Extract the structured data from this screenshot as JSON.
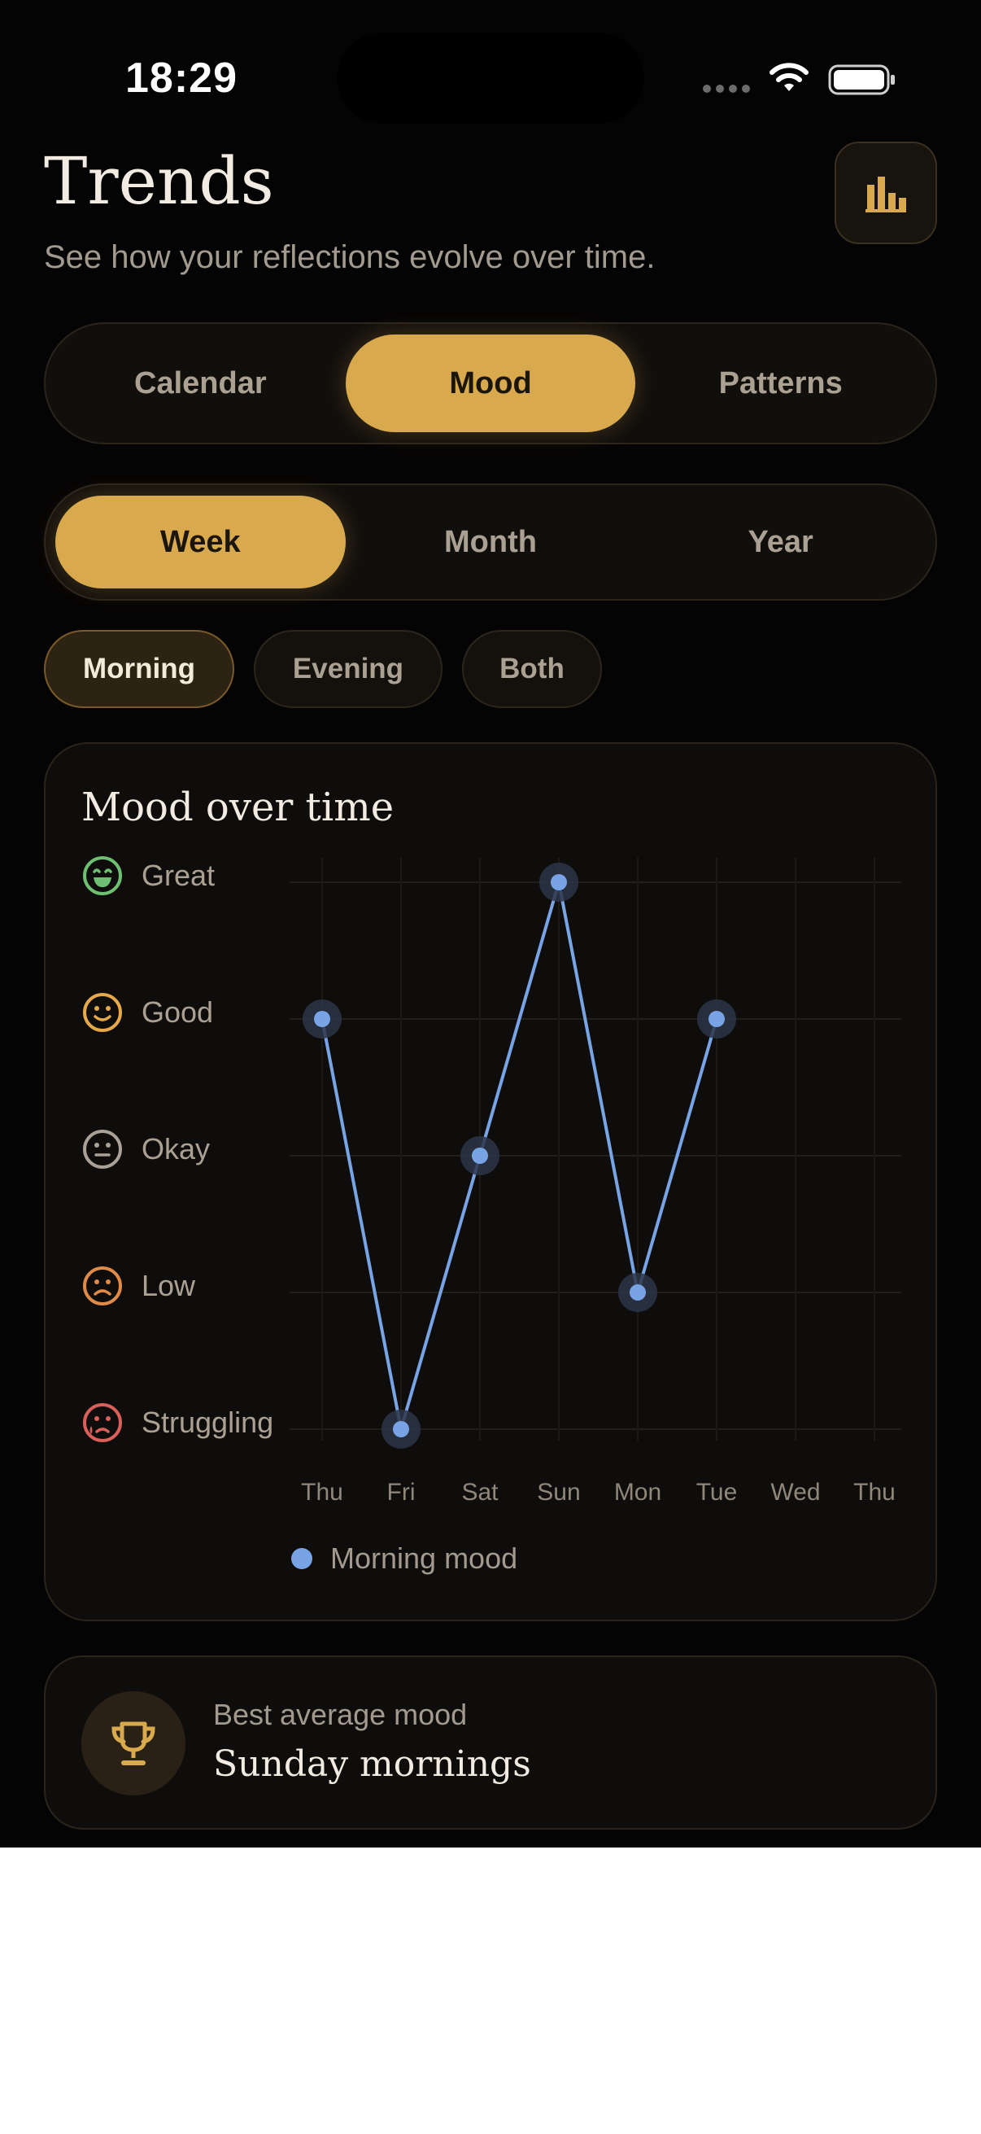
{
  "status_bar": {
    "time": "18:29"
  },
  "header": {
    "title": "Trends",
    "subtitle": "See how your reflections evolve over time.",
    "chart_button_icon": "bar-chart-icon"
  },
  "view_tabs": [
    {
      "label": "Calendar",
      "active": false
    },
    {
      "label": "Mood",
      "active": true
    },
    {
      "label": "Patterns",
      "active": false
    }
  ],
  "range_tabs": [
    {
      "label": "Week",
      "active": true
    },
    {
      "label": "Month",
      "active": false
    },
    {
      "label": "Year",
      "active": false
    }
  ],
  "time_chips": [
    {
      "label": "Morning",
      "active": true
    },
    {
      "label": "Evening",
      "active": false
    },
    {
      "label": "Both",
      "active": false
    }
  ],
  "chart_card": {
    "title": "Mood over time",
    "mood_levels": [
      {
        "label": "Great",
        "icon": "grin-face-icon",
        "color": "#6fbf73"
      },
      {
        "label": "Good",
        "icon": "smile-face-icon",
        "color": "#e6a94a"
      },
      {
        "label": "Okay",
        "icon": "neutral-face-icon",
        "color": "#a9a195"
      },
      {
        "label": "Low",
        "icon": "frown-face-icon",
        "color": "#e08a48"
      },
      {
        "label": "Struggling",
        "icon": "crying-face-icon",
        "color": "#d9605a"
      }
    ]
  },
  "chart_data": {
    "type": "line",
    "title": "Mood over time",
    "categories": [
      "Thu",
      "Fri",
      "Sat",
      "Sun",
      "Mon",
      "Tue",
      "Wed",
      "Thu"
    ],
    "y_levels": [
      "Struggling",
      "Low",
      "Okay",
      "Good",
      "Great"
    ],
    "series": [
      {
        "name": "Morning mood",
        "color": "#78a4e6",
        "values": [
          4,
          1,
          3,
          5,
          2,
          4,
          null,
          null
        ]
      }
    ],
    "ylim": [
      1,
      5
    ],
    "grid": true,
    "legend": "bottom"
  },
  "insight": {
    "label": "Best average mood",
    "value": "Sunday mornings",
    "icon": "trophy-icon"
  },
  "colors": {
    "accent": "#d9a94e",
    "background": "#050404",
    "card": "#0f0d0b",
    "line": "#78a4e6"
  }
}
